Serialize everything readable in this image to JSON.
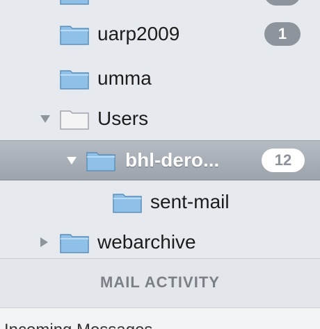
{
  "mailboxes": [
    {
      "label": "uarp2009",
      "badge": "1",
      "icon": "folder-icon"
    },
    {
      "label": "umma",
      "icon": "folder-icon"
    },
    {
      "label": "Users",
      "icon": "folder-icon",
      "disclosure": "expanded"
    },
    {
      "label": "bhl-dero...",
      "badge": "12",
      "icon": "folder-icon",
      "disclosure": "expanded",
      "selected": true
    },
    {
      "label": "sent-mail",
      "icon": "folder-icon"
    },
    {
      "label": "webarchive",
      "icon": "folder-icon",
      "disclosure": "collapsed"
    }
  ],
  "activity": {
    "header": "MAIL ACTIVITY",
    "status": "Incoming Messages"
  },
  "colors": {
    "sidebar_bg": "#e6eaef",
    "selected_row": "#9ca3ab",
    "badge": "#8e949b",
    "folder_blue": "#7fb5e0"
  }
}
